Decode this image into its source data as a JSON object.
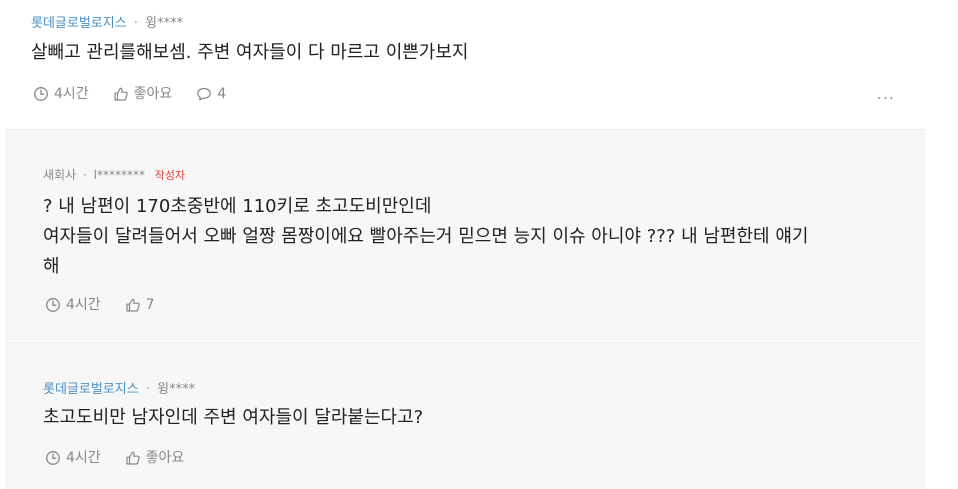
{
  "comments": [
    {
      "company": "롯데글로벌로지스",
      "separator": "·",
      "user": "윙****",
      "text_lines": [
        "살빼고 관리를해보셈. 주변 여자들이 다 마르고 이쁜가보지"
      ],
      "time": "4시간",
      "like_label": "좋아요",
      "reply_count": "4",
      "more_label": "..."
    },
    {
      "company": "새회사",
      "separator": "·",
      "user": "l********",
      "author_tag": "작성자",
      "text_lines": [
        "? 내 남편이 170초중반에 110키로 초고도비만인데",
        "여자들이 달려들어서 오빠 얼짱 몸짱이에요 빨아주는거 믿으면 능지 이슈 아니야 ??? 내 남편한테 얘기",
        "해"
      ],
      "time": "4시간",
      "like_count": "7"
    },
    {
      "company": "롯데글로벌로지스",
      "separator": "·",
      "user": "윙****",
      "text_lines": [
        "초고도비만 남자인데 주변 여자들이 달라붙는다고?"
      ],
      "time": "4시간",
      "like_label": "좋아요"
    }
  ],
  "colors": {
    "company": "#4a90c8",
    "meta": "#888888",
    "author_tag": "#e0453a",
    "reply_bg": "#f7f7f7",
    "text": "#222222"
  },
  "icons": {
    "time": "clock-icon",
    "like": "thumbs-up-icon",
    "reply": "speech-bubble-icon",
    "more": "more-dots-icon"
  }
}
